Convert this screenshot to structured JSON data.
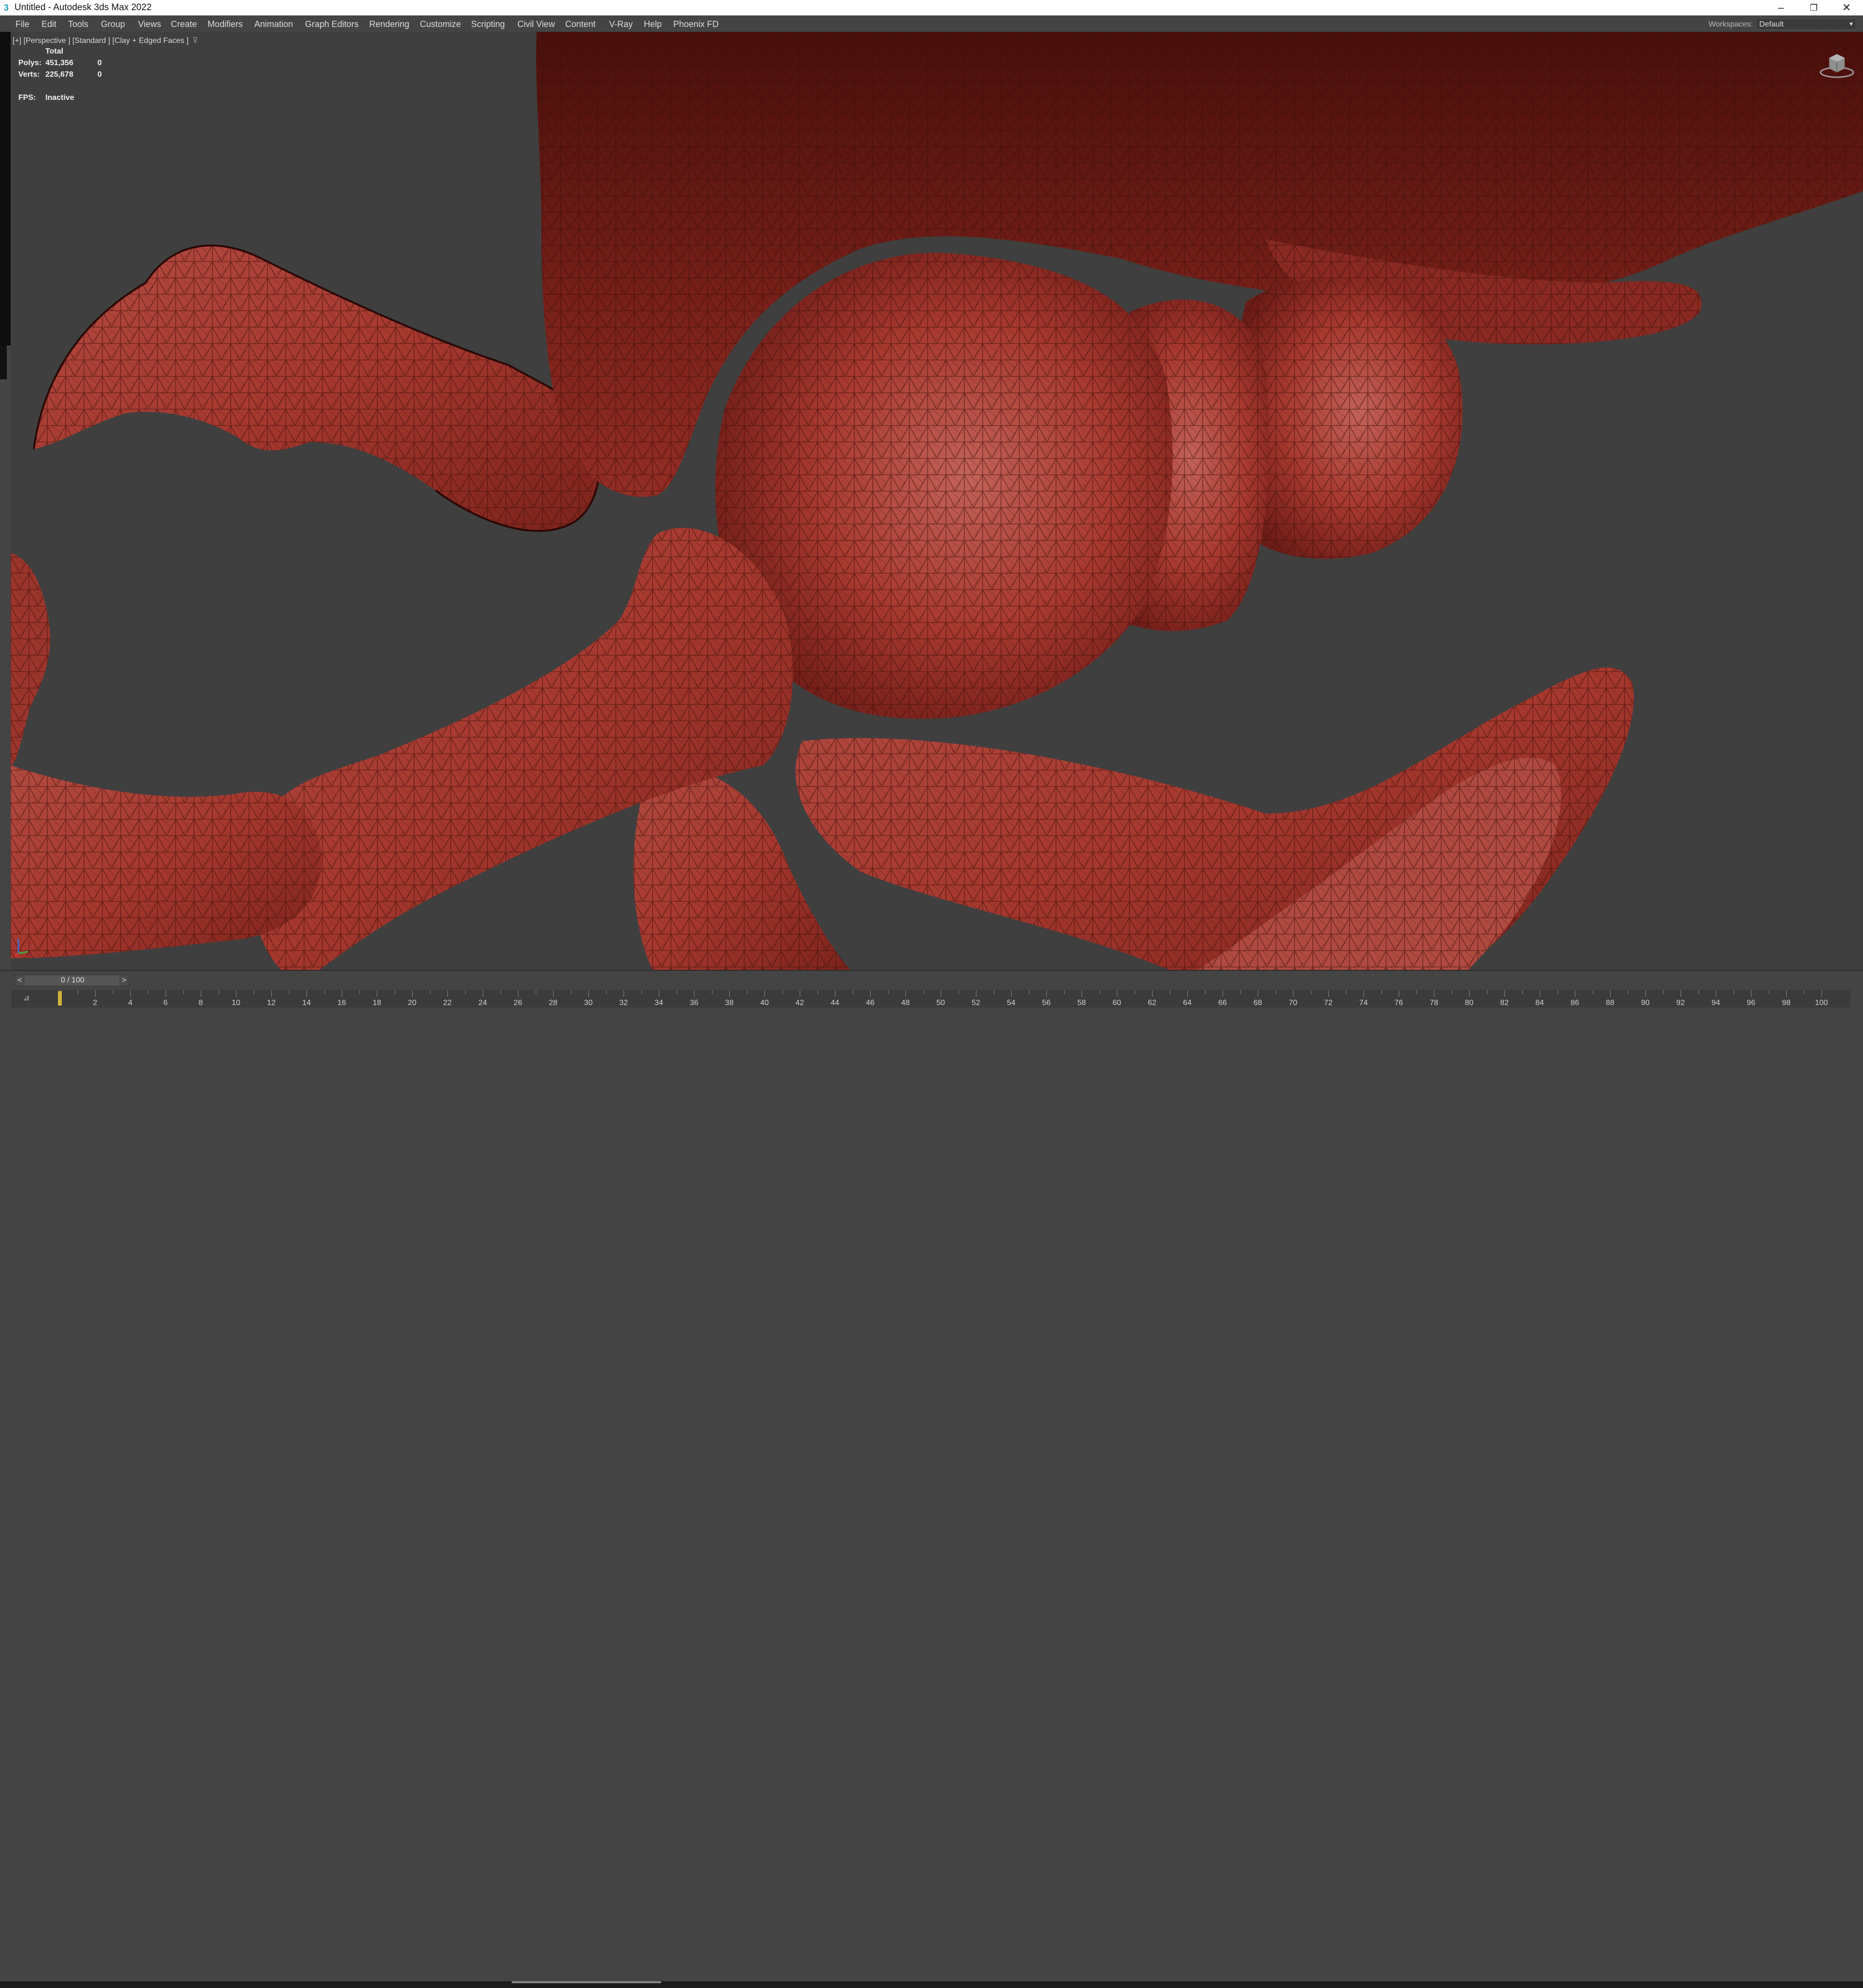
{
  "window": {
    "title": "Untitled - Autodesk 3ds Max 2022",
    "app_icon": "3",
    "minimize_icon": "–",
    "restore_icon": "❐",
    "close_icon": "✕"
  },
  "menu": {
    "items": [
      "File",
      "Edit",
      "Tools",
      "Group",
      "Views",
      "Create",
      "Modifiers",
      "Animation",
      "Graph Editors",
      "Rendering",
      "Customize",
      "Scripting",
      "Civil View",
      "Content",
      "V-Ray",
      "Help",
      "Phoenix FD"
    ],
    "workspaces_label": "Workspaces:",
    "workspaces_value": "Default",
    "workspaces_chevron": "▾"
  },
  "viewport": {
    "label": "[+] [Perspective ] [Standard ] [Clay + Edged Faces ]",
    "filter_icon": "⊽",
    "stats": {
      "header": "Total",
      "polys_label": "Polys:",
      "polys_total": "451,356",
      "polys_sel": "0",
      "verts_label": "Verts:",
      "verts_total": "225,678",
      "verts_sel": "0",
      "fps_label": "FPS:",
      "fps_value": "Inactive"
    },
    "mesh_color": "#a83a30",
    "background_color": "#3f3f3f"
  },
  "timeline": {
    "prev_icon": "<",
    "next_icon": ">",
    "value": "0 / 100",
    "key_icon": "⊿",
    "ticks": [
      "0",
      "2",
      "4",
      "6",
      "8",
      "10",
      "12",
      "14",
      "16",
      "18",
      "20",
      "22",
      "24",
      "26",
      "28",
      "30",
      "32",
      "34",
      "36",
      "38",
      "40",
      "42",
      "44",
      "46",
      "48",
      "50",
      "52",
      "54",
      "56",
      "58",
      "60",
      "62",
      "64",
      "66",
      "68",
      "70",
      "72",
      "74",
      "76",
      "78",
      "80",
      "82",
      "84",
      "86",
      "88",
      "90",
      "92",
      "94",
      "96",
      "98",
      "100"
    ]
  }
}
